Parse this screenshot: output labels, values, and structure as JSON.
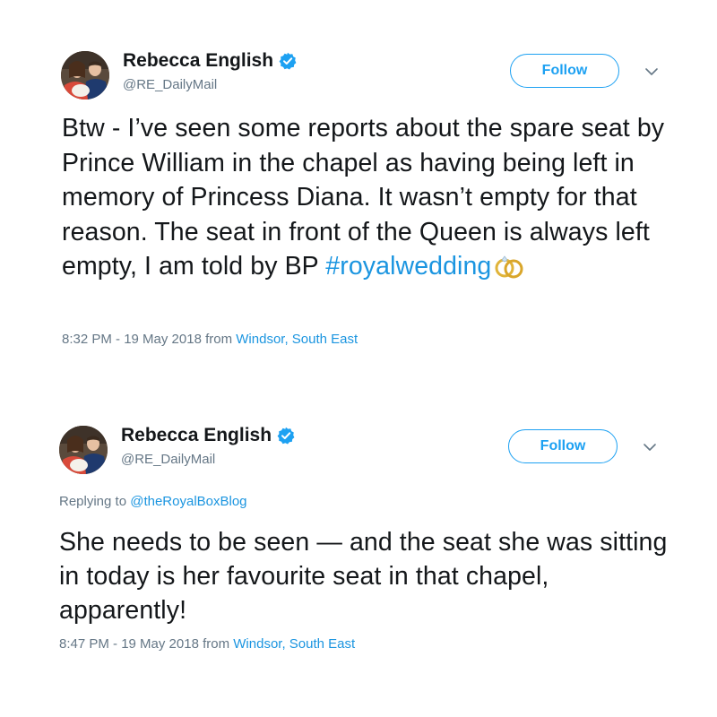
{
  "tweets": [
    {
      "author_name": "Rebecca English",
      "handle": "@RE_DailyMail",
      "follow_label": "Follow",
      "text_before": "Btw - I’ve seen some reports about the spare seat by Prince William in the chapel as having being left in memory of Princess Diana. It wasn’t empty for that reason. The seat in front of the Queen is always left empty, I am told by BP ",
      "hashtag": "#royalwedding",
      "emoji_icon": "wedding-rings-icon",
      "timestamp": "8:32 PM - 19 May 2018 from ",
      "location": "Windsor, South East"
    },
    {
      "author_name": "Rebecca English",
      "handle": "@RE_DailyMail",
      "follow_label": "Follow",
      "replying_to_label": "Replying to ",
      "replying_to_handle": "@theRoyalBoxBlog",
      "text": "She needs to be seen — and the seat she was sitting in today is her favourite seat in that chapel, apparently!",
      "timestamp": "8:47 PM - 19 May 2018 from ",
      "location": "Windsor, South East"
    }
  ],
  "colors": {
    "accent": "#1da1f2",
    "link": "#1b95e0",
    "muted": "#657786",
    "text": "#14171a"
  }
}
